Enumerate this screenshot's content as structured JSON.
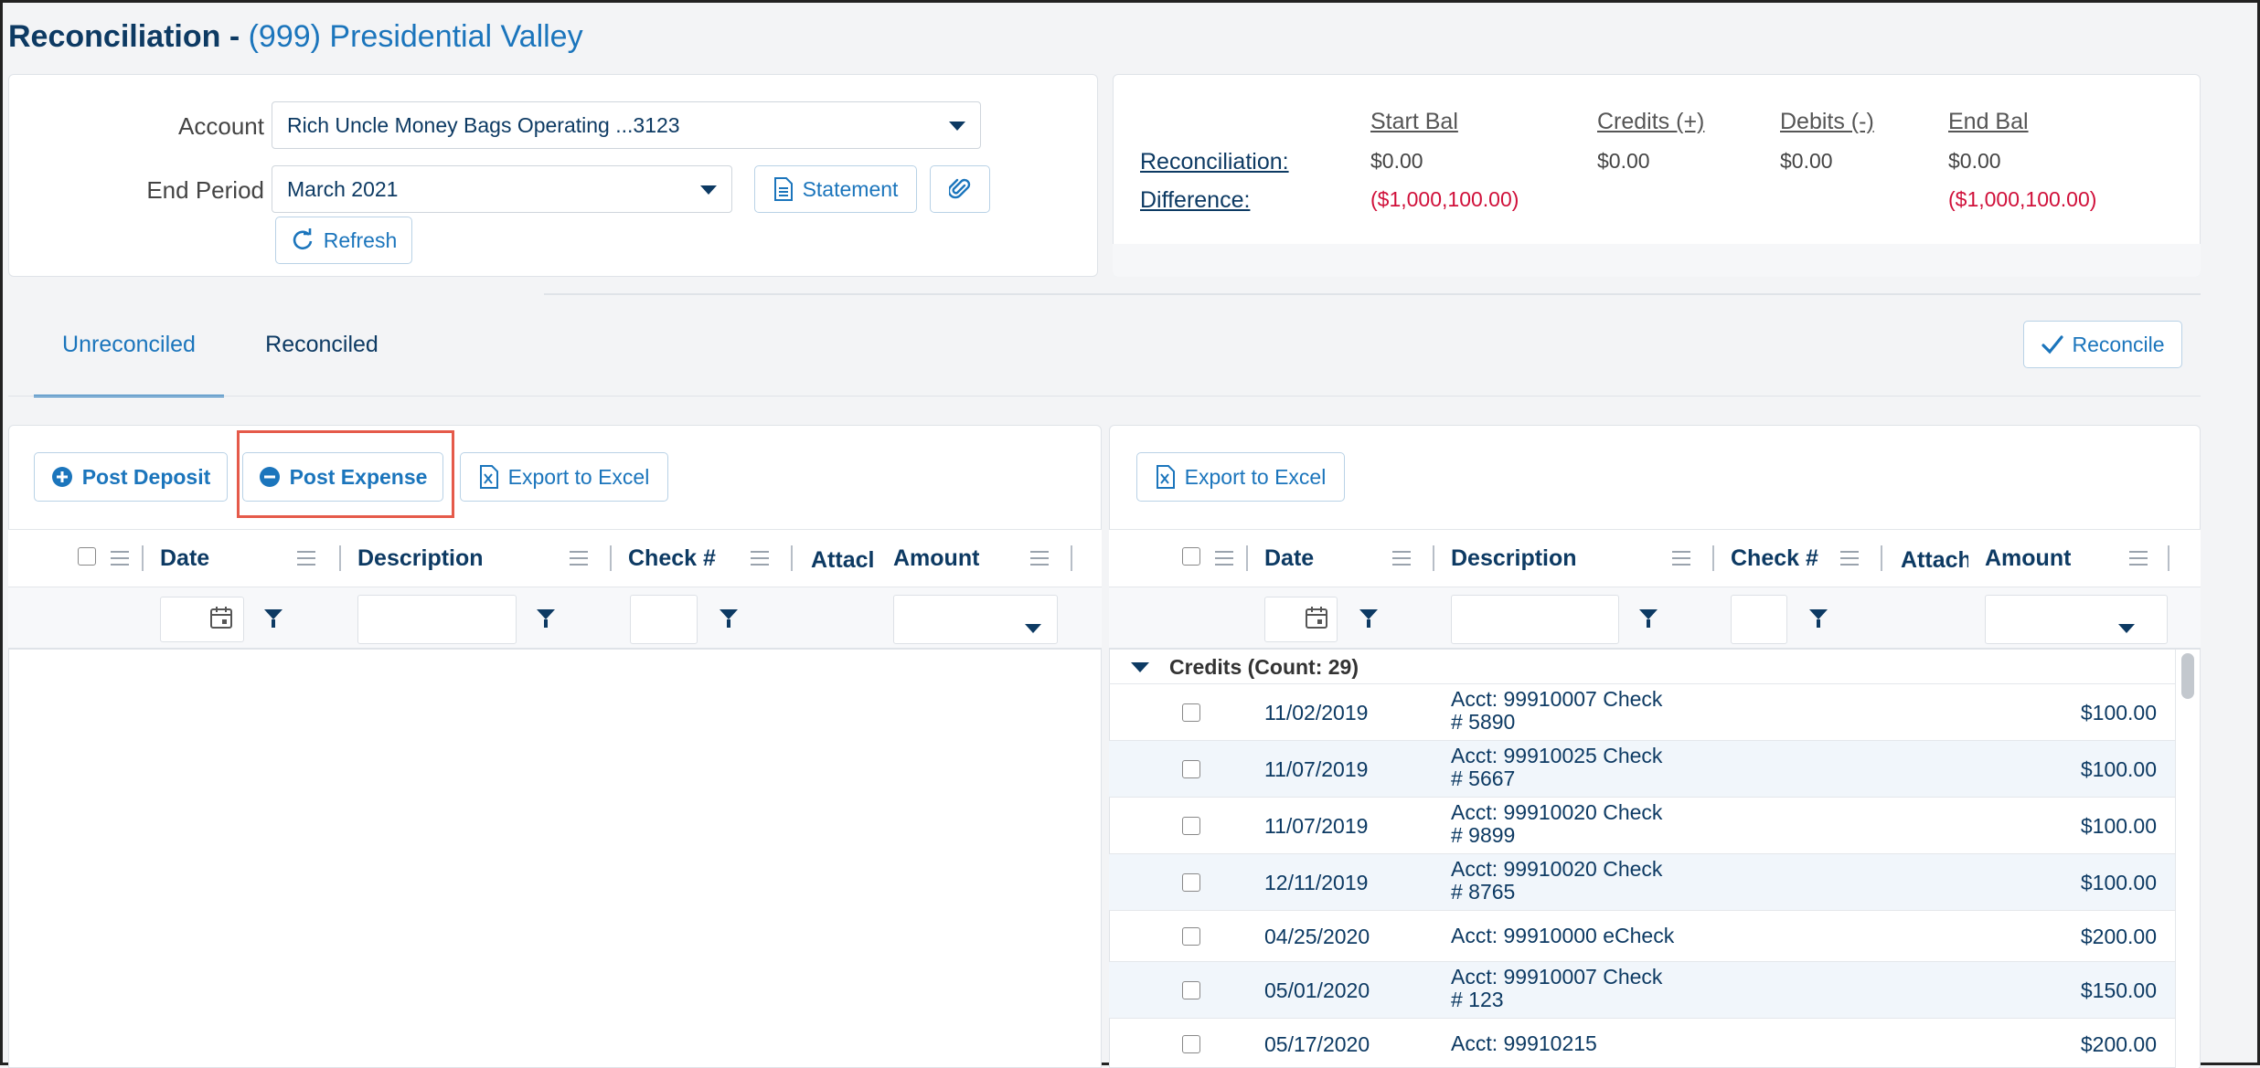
{
  "header": {
    "title": "Reconciliation - ",
    "property": "(999) Presidential Valley"
  },
  "form": {
    "account_label": "Account",
    "account_value": "Rich Uncle Money Bags Operating ...3123",
    "end_period_label": "End Period",
    "end_period_value": "March 2021",
    "statement_button": "Statement",
    "refresh_button": "Refresh"
  },
  "summary": {
    "headers": [
      "Start Bal",
      "Credits (+)",
      "Debits (-)",
      "End Bal"
    ],
    "reconciliation_label": "Reconciliation:",
    "difference_label": "Difference:",
    "reconciliation_values": [
      "$0.00",
      "$0.00",
      "$0.00",
      "$0.00"
    ],
    "difference_start": "($1,000,100.00)",
    "difference_end": "($1,000,100.00)",
    "negative_color": "#d0103a"
  },
  "tabs": {
    "unreconciled": "Unreconciled",
    "reconciled": "Reconciled",
    "active": "Unreconciled"
  },
  "reconcile_button": "Reconcile",
  "left_grid": {
    "post_deposit": "Post Deposit",
    "post_expense": "Post Expense",
    "export": "Export to Excel",
    "columns": [
      "Date",
      "Description",
      "Check #",
      "Attacl",
      "Amount"
    ]
  },
  "right_grid": {
    "export": "Export to Excel",
    "columns": [
      "Date",
      "Description",
      "Check #",
      "Attach",
      "Amount"
    ],
    "group_label": "Credits (Count: 29)",
    "rows": [
      {
        "date": "11/02/2019",
        "desc1": "Acct: 99910007 Check",
        "desc2": "# 5890",
        "amount": "$100.00"
      },
      {
        "date": "11/07/2019",
        "desc1": "Acct: 99910025 Check",
        "desc2": "# 5667",
        "amount": "$100.00"
      },
      {
        "date": "11/07/2019",
        "desc1": "Acct: 99910020 Check",
        "desc2": "# 9899",
        "amount": "$100.00"
      },
      {
        "date": "12/11/2019",
        "desc1": "Acct: 99910020 Check",
        "desc2": "# 8765",
        "amount": "$100.00"
      },
      {
        "date": "04/25/2020",
        "desc1": "Acct: 99910000 eCheck",
        "desc2": "",
        "amount": "$200.00"
      },
      {
        "date": "05/01/2020",
        "desc1": "Acct: 99910007 Check",
        "desc2": "# 123",
        "amount": "$150.00"
      },
      {
        "date": "05/17/2020",
        "desc1": "Acct: 99910215",
        "desc2": "",
        "amount": "$200.00"
      }
    ]
  },
  "colors": {
    "brand_dark": "#0d3a63",
    "link_blue": "#1b75bc",
    "highlight": "#e55a4a"
  }
}
